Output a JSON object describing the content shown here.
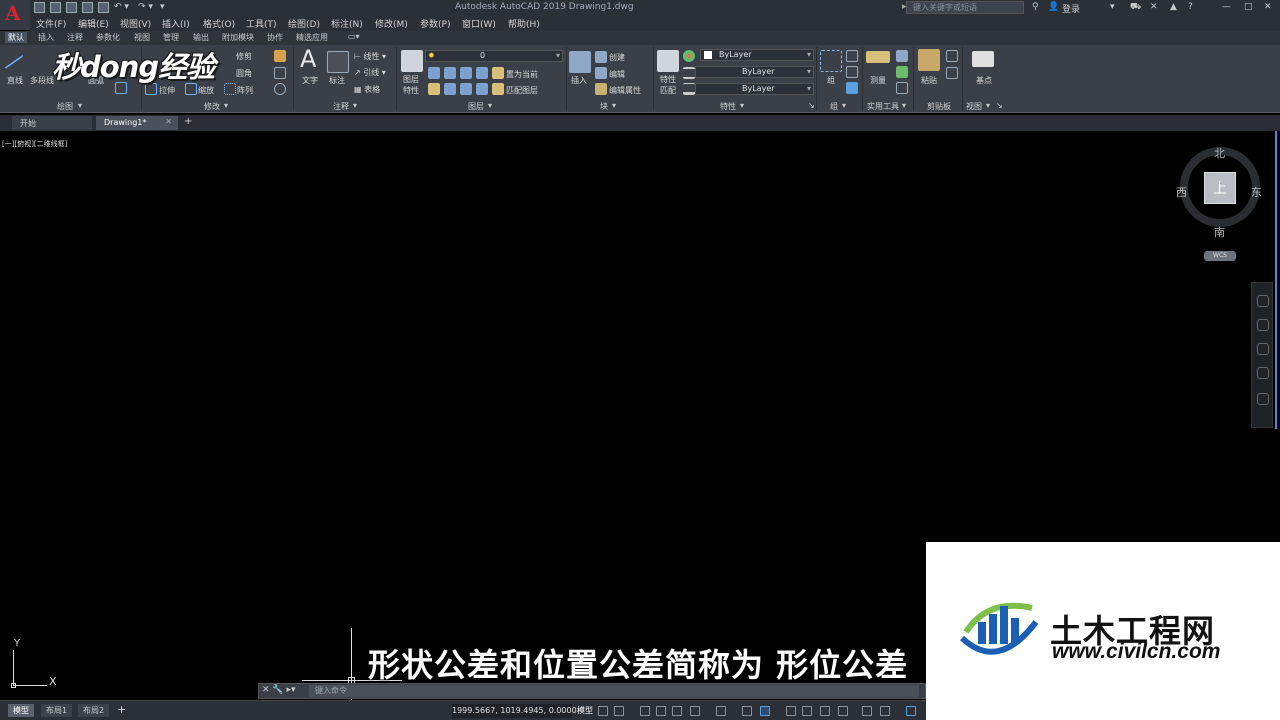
{
  "window": {
    "title": "Autodesk AutoCAD 2019    Drawing1.dwg",
    "search_placeholder": "键入关键字或短语",
    "login": "登录"
  },
  "menu": [
    "文件(F)",
    "编辑(E)",
    "视图(V)",
    "插入(I)",
    "格式(O)",
    "工具(T)",
    "绘图(D)",
    "标注(N)",
    "修改(M)",
    "参数(P)",
    "窗口(W)",
    "帮助(H)"
  ],
  "ribbon_tabs": [
    "默认",
    "插入",
    "注释",
    "参数化",
    "视图",
    "管理",
    "输出",
    "附加模块",
    "协作",
    "精选应用"
  ],
  "ribbon": {
    "draw": {
      "line": "直线",
      "polyline": "多段线",
      "circle": "圆弧",
      "title": "绘图"
    },
    "modify": {
      "move": "移动",
      "trim": "修剪",
      "fillet": "圆角",
      "stretch": "拉伸",
      "scale": "缩放",
      "array": "阵列",
      "title": "修改"
    },
    "annotation": {
      "text": "文字",
      "dimension": "标注",
      "linear": "线性",
      "leader": "引线",
      "table": "表格",
      "title": "注释"
    },
    "layers": {
      "properties_line1": "图层",
      "properties_line2": "特性",
      "current_layer": "0",
      "set_current": "置为当前",
      "match_layer": "匹配图层",
      "title": "图层"
    },
    "block": {
      "insert": "插入",
      "create": "创建",
      "edit": "编辑",
      "edit_attr": "编辑属性",
      "title": "块"
    },
    "properties": {
      "match_line1": "特性",
      "match_line2": "匹配",
      "color": "ByLayer",
      "linetype": "ByLayer",
      "lineweight": "ByLayer",
      "title": "特性"
    },
    "groups": {
      "group": "组",
      "title": "组"
    },
    "utilities": {
      "measure": "测量",
      "title": "实用工具"
    },
    "clipboard": {
      "paste": "粘贴",
      "title": "剪贴板"
    },
    "view": {
      "base": "基点",
      "title": "视图"
    }
  },
  "logo_watermark": "秒dong经验",
  "doc_tabs": {
    "start": "开始",
    "drawing": "Drawing1*"
  },
  "viewport_label": "[一][俯视][二维线框]",
  "viewcube": {
    "north": "北",
    "south": "南",
    "east": "东",
    "west": "西",
    "face": "上",
    "wcs": "WCS"
  },
  "ucs": {
    "x": "X",
    "y": "Y"
  },
  "subtitle": "形状公差和位置公差简称为 形位公差",
  "command": {
    "placeholder": "键入命令"
  },
  "status": {
    "layout_tabs": [
      "模型",
      "布局1",
      "布局2"
    ],
    "coordinates": "1999.5667, 1019.4945, 0.0000",
    "space": "模型"
  },
  "watermark_site": {
    "name": "土木工程网",
    "url": "www.civilcn.com"
  }
}
